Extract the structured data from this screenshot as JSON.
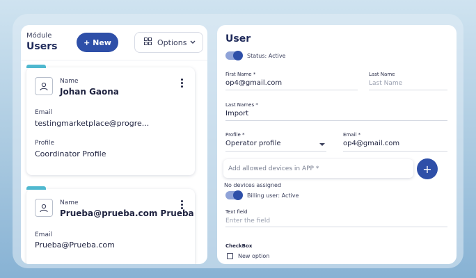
{
  "left_panel": {
    "module_label": "Módule",
    "title": "Users",
    "new_button": "+ New",
    "options_button": "Options",
    "cards": [
      {
        "name_label": "Name",
        "name": "Johan Gaona",
        "email_label": "Email",
        "email": "testingmarketplace@progre...",
        "profile_label": "Profile",
        "profile": "Coordinator Profile"
      },
      {
        "name_label": "Name",
        "name": "Prueba@prueba.com Prueba",
        "email_label": "Email",
        "email": "Prueba@Prueba.com"
      }
    ]
  },
  "right_panel": {
    "title": "User",
    "status_label": "Status: Active",
    "first_name_label": "First Name *",
    "first_name_value": "op4@gmail.com",
    "last_name_label": "Last Name",
    "last_name_placeholder": "Last Name",
    "last_names_label": "Last Names *",
    "last_names_value": "Import",
    "profile_label": "Profile *",
    "profile_value": "Operator profile",
    "email_label": "Email *",
    "email_value": "op4@gmail.com",
    "devices_placeholder": "Add allowed devices in APP *",
    "add_button": "+",
    "no_devices": "No devices assigned",
    "billing_label": "Billing user: Active",
    "text_field_label": "Text field",
    "text_field_placeholder": "Enter the field",
    "checkbox_section": "CheckBox",
    "checkbox_option": "New option"
  },
  "colors": {
    "accent": "#2e4fa8",
    "card_tab": "#4fb8cf",
    "toggle_track": "#8fa3d8"
  }
}
